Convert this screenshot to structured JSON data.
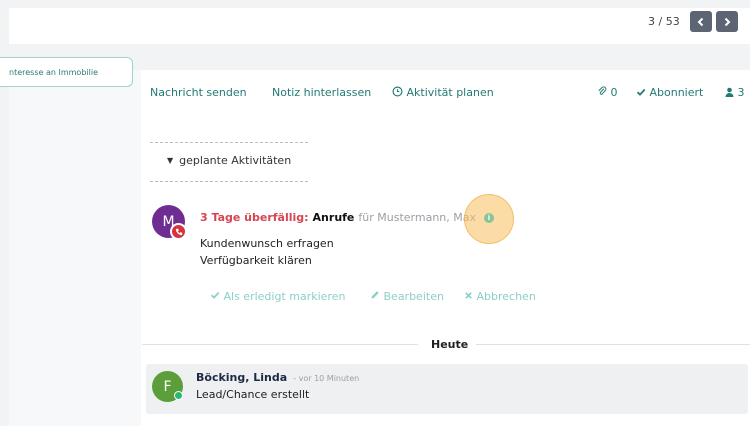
{
  "pager": {
    "position": "3 / 53"
  },
  "stage": {
    "label": "nteresse an Immobilie"
  },
  "chatter": {
    "send_message": "Nachricht senden",
    "log_note": "Notiz hinterlassen",
    "schedule_activity": "Aktivität planen",
    "attachments_count": "0",
    "follow_state": "Abonniert",
    "followers_count": "3"
  },
  "activities": {
    "toggle_label": "geplante Aktivitäten",
    "item": {
      "avatar_letter": "M",
      "overdue_label": "3 Tage überfällig:",
      "type": "Anrufe",
      "assignee_text": "für Mustermann, Max",
      "notes": [
        "Kundenwunsch erfragen",
        "Verfügbarkeit klären"
      ],
      "actions": {
        "mark_done": "Als erledigt markieren",
        "edit": "Bearbeiten",
        "cancel": "Abbrechen"
      }
    }
  },
  "separator": {
    "label": "Heute"
  },
  "message": {
    "avatar_letter": "F",
    "author": "Böcking, Linda",
    "time_ago": "- vor 10 Minuten",
    "body": "Lead/Chance erstellt"
  },
  "colors": {
    "accent": "#237a75",
    "overdue": "#d64550",
    "avatar_m": "#6f2c91",
    "avatar_f": "#5b9e3a",
    "pager_button": "#5d6574",
    "highlight": "#f8c05f"
  }
}
